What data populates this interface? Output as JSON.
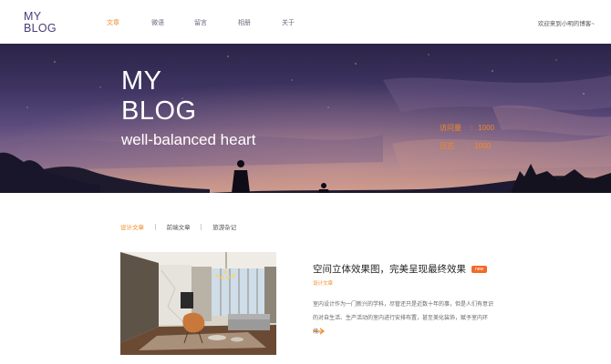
{
  "header": {
    "logo_line1": "MY",
    "logo_line2": "BLOG",
    "nav": [
      "文章",
      "微语",
      "留言",
      "相册",
      "关于"
    ],
    "active_nav": "文章",
    "welcome": "欢迎来到小明的博客~"
  },
  "hero": {
    "title_line1": "MY",
    "title_line2": "BLOG",
    "subtitle": "well-balanced heart",
    "stats": [
      {
        "label": "访问量",
        "value": "1000"
      },
      {
        "label": "日志",
        "value": "1000"
      }
    ]
  },
  "categories": {
    "items": [
      "设计文章",
      "前端文章",
      "旅游杂记"
    ],
    "active": "设计文章"
  },
  "article": {
    "title": "空间立体效果图，完美呈现最终效果",
    "badge": "new",
    "category": "设计文章",
    "desc": "室内设计作为一门新兴的学科，尽管还只是近数十年的事，但是人们有意识的对自生活、生产活动的室内进行安排布置，甚至美化装饰，赋予室内环境..."
  },
  "colors": {
    "accent": "#f08a24",
    "badge": "#f26a2a",
    "logo": "#4a3b7a"
  },
  "icons": {
    "read_more": "arrow-right-icon"
  }
}
